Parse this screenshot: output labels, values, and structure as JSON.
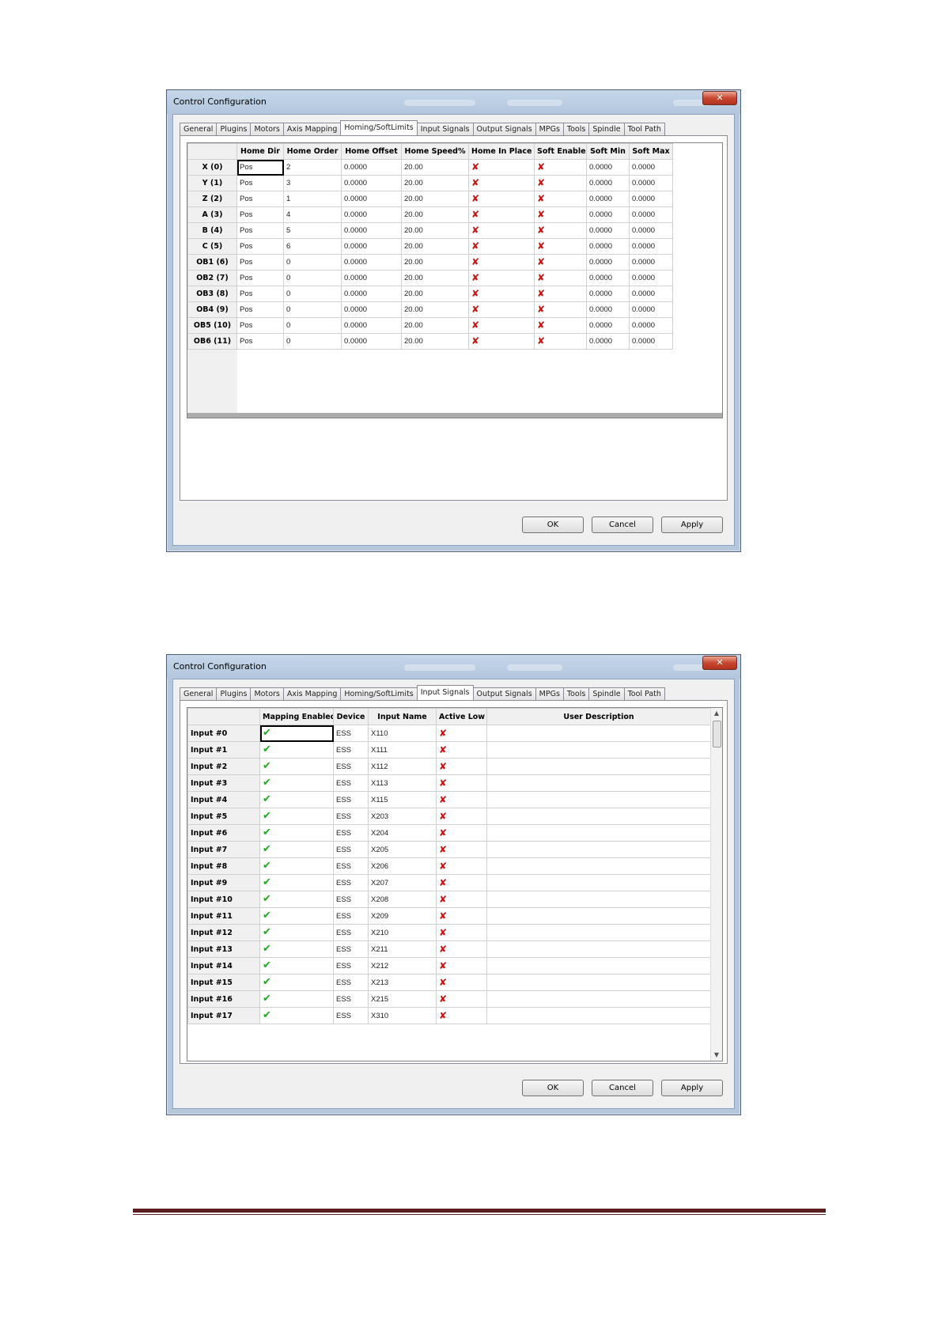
{
  "dialog1": {
    "title": "Control Configuration",
    "close_label": "✕",
    "tabs": [
      "General",
      "Plugins",
      "Motors",
      "Axis Mapping",
      "Homing/SoftLimits",
      "Input Signals",
      "Output Signals",
      "MPGs",
      "Tools",
      "Spindle",
      "Tool Path"
    ],
    "active_tab": "Homing/SoftLimits",
    "columns": [
      "Home Dir",
      "Home Order",
      "Home Offset",
      "Home Speed%",
      "Home In Place",
      "Soft Enable",
      "Soft Min",
      "Soft Max"
    ],
    "rows": [
      {
        "axis": "X (0)",
        "home_dir": "Pos",
        "home_order": "2",
        "home_offset": "0.0000",
        "home_speed": "20.00",
        "soft_min": "0.0000",
        "soft_max": "0.0000"
      },
      {
        "axis": "Y (1)",
        "home_dir": "Pos",
        "home_order": "3",
        "home_offset": "0.0000",
        "home_speed": "20.00",
        "soft_min": "0.0000",
        "soft_max": "0.0000"
      },
      {
        "axis": "Z (2)",
        "home_dir": "Pos",
        "home_order": "1",
        "home_offset": "0.0000",
        "home_speed": "20.00",
        "soft_min": "0.0000",
        "soft_max": "0.0000"
      },
      {
        "axis": "A (3)",
        "home_dir": "Pos",
        "home_order": "4",
        "home_offset": "0.0000",
        "home_speed": "20.00",
        "soft_min": "0.0000",
        "soft_max": "0.0000"
      },
      {
        "axis": "B (4)",
        "home_dir": "Pos",
        "home_order": "5",
        "home_offset": "0.0000",
        "home_speed": "20.00",
        "soft_min": "0.0000",
        "soft_max": "0.0000"
      },
      {
        "axis": "C (5)",
        "home_dir": "Pos",
        "home_order": "6",
        "home_offset": "0.0000",
        "home_speed": "20.00",
        "soft_min": "0.0000",
        "soft_max": "0.0000"
      },
      {
        "axis": "OB1 (6)",
        "home_dir": "Pos",
        "home_order": "0",
        "home_offset": "0.0000",
        "home_speed": "20.00",
        "soft_min": "0.0000",
        "soft_max": "0.0000"
      },
      {
        "axis": "OB2 (7)",
        "home_dir": "Pos",
        "home_order": "0",
        "home_offset": "0.0000",
        "home_speed": "20.00",
        "soft_min": "0.0000",
        "soft_max": "0.0000"
      },
      {
        "axis": "OB3 (8)",
        "home_dir": "Pos",
        "home_order": "0",
        "home_offset": "0.0000",
        "home_speed": "20.00",
        "soft_min": "0.0000",
        "soft_max": "0.0000"
      },
      {
        "axis": "OB4 (9)",
        "home_dir": "Pos",
        "home_order": "0",
        "home_offset": "0.0000",
        "home_speed": "20.00",
        "soft_min": "0.0000",
        "soft_max": "0.0000"
      },
      {
        "axis": "OB5 (10)",
        "home_dir": "Pos",
        "home_order": "0",
        "home_offset": "0.0000",
        "home_speed": "20.00",
        "soft_min": "0.0000",
        "soft_max": "0.0000"
      },
      {
        "axis": "OB6 (11)",
        "home_dir": "Pos",
        "home_order": "0",
        "home_offset": "0.0000",
        "home_speed": "20.00",
        "soft_min": "0.0000",
        "soft_max": "0.0000"
      }
    ],
    "buttons": {
      "ok": "OK",
      "cancel": "Cancel",
      "apply": "Apply"
    }
  },
  "dialog2": {
    "title": "Control Configuration",
    "close_label": "✕",
    "tabs": [
      "General",
      "Plugins",
      "Motors",
      "Axis Mapping",
      "Homing/SoftLimits",
      "Input Signals",
      "Output Signals",
      "MPGs",
      "Tools",
      "Spindle",
      "Tool Path"
    ],
    "active_tab": "Input Signals",
    "columns": [
      "Mapping Enabled",
      "Device",
      "Input Name",
      "Active Low",
      "User Description"
    ],
    "rows": [
      {
        "label": "Input #0",
        "device": "ESS",
        "input_name": "X110"
      },
      {
        "label": "Input #1",
        "device": "ESS",
        "input_name": "X111"
      },
      {
        "label": "Input #2",
        "device": "ESS",
        "input_name": "X112"
      },
      {
        "label": "Input #3",
        "device": "ESS",
        "input_name": "X113"
      },
      {
        "label": "Input #4",
        "device": "ESS",
        "input_name": "X115"
      },
      {
        "label": "Input #5",
        "device": "ESS",
        "input_name": "X203"
      },
      {
        "label": "Input #6",
        "device": "ESS",
        "input_name": "X204"
      },
      {
        "label": "Input #7",
        "device": "ESS",
        "input_name": "X205"
      },
      {
        "label": "Input #8",
        "device": "ESS",
        "input_name": "X206"
      },
      {
        "label": "Input #9",
        "device": "ESS",
        "input_name": "X207"
      },
      {
        "label": "Input #10",
        "device": "ESS",
        "input_name": "X208"
      },
      {
        "label": "Input #11",
        "device": "ESS",
        "input_name": "X209"
      },
      {
        "label": "Input #12",
        "device": "ESS",
        "input_name": "X210"
      },
      {
        "label": "Input #13",
        "device": "ESS",
        "input_name": "X211"
      },
      {
        "label": "Input #14",
        "device": "ESS",
        "input_name": "X212"
      },
      {
        "label": "Input #15",
        "device": "ESS",
        "input_name": "X213"
      },
      {
        "label": "Input #16",
        "device": "ESS",
        "input_name": "X215"
      },
      {
        "label": "Input #17",
        "device": "ESS",
        "input_name": "X310"
      }
    ],
    "buttons": {
      "ok": "OK",
      "cancel": "Cancel",
      "apply": "Apply"
    }
  },
  "icons": {
    "cross": "✘",
    "check": "✔"
  },
  "colors": {
    "cross": "#cc1010",
    "check": "#22a822",
    "footer_rule": "#5c1f1f"
  }
}
